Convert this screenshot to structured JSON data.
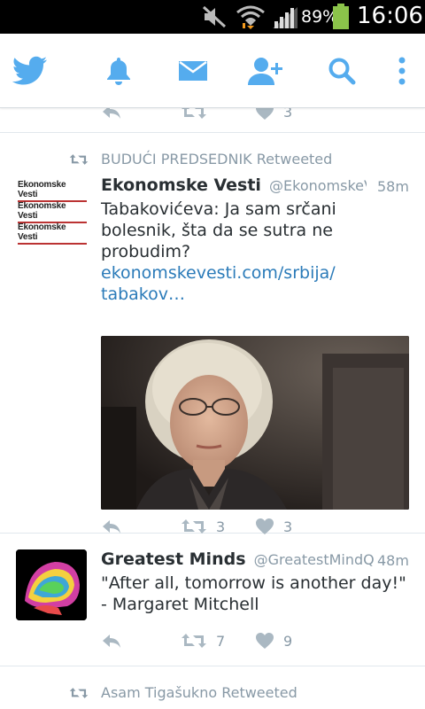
{
  "status_bar": {
    "battery_percent": "89%",
    "clock": "16:06"
  },
  "nav": {
    "items": [
      {
        "icon": "twitter-bird-icon"
      },
      {
        "icon": "bell-icon"
      },
      {
        "icon": "envelope-icon"
      },
      {
        "icon": "add-user-icon"
      },
      {
        "icon": "search-icon"
      },
      {
        "icon": "more-vertical-icon"
      }
    ],
    "accent": "#55acee"
  },
  "timeline": {
    "partial_top_tweet": {
      "retweets": "",
      "likes": "3"
    },
    "tweets": [
      {
        "retweeted_by": "BUDUĆI PREDSEDNIK Retweeted",
        "name": "Ekonomske Vesti",
        "handle": "@EkonomskeV...",
        "time": "58m",
        "text": "Tabakovićeva: Ja sam srčani bolesnik, šta da se sutra ne probudim?",
        "link_line1": "ekonomskevesti.com/srbija/",
        "link_line2": "tabakov…",
        "avatar_logo": "Ekonomske Vesti",
        "retweets": "3",
        "likes": "3"
      },
      {
        "name": "Greatest Minds",
        "handle": "@GreatestMindQ",
        "time": "48m",
        "text": "\"After all, tomorrow is another day!\" - Margaret Mitchell",
        "retweets": "7",
        "likes": "9"
      }
    ],
    "bottom_retweet_line": "Asam Tigašukno Retweeted"
  },
  "colors": {
    "text": "#292f33",
    "muted": "#8899a6",
    "link": "#2b7bb9"
  }
}
